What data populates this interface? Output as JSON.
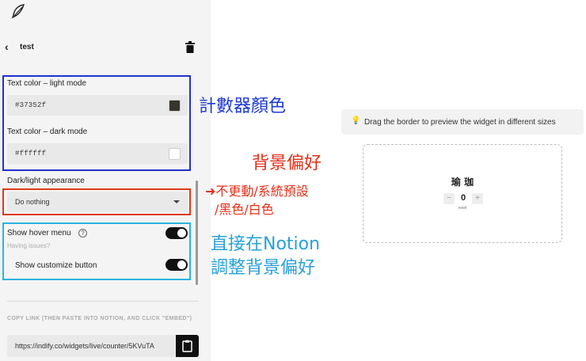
{
  "header": {
    "title": "test"
  },
  "settings": {
    "text_color_light": {
      "label": "Text color – light mode",
      "value": "#37352f",
      "swatch": "#37352f"
    },
    "text_color_dark": {
      "label": "Text color – dark mode",
      "value": "#ffffff",
      "swatch": "#ffffff"
    },
    "appearance": {
      "label": "Dark/light appearance",
      "selected": "Do nothing"
    },
    "hover_menu": {
      "label": "Show hover menu",
      "help": "?",
      "sub_label": "Having issues?"
    },
    "customize_button": {
      "label": "Show customize button"
    }
  },
  "copy_link": {
    "caption": "COPY LINK (THEN PASTE INTO NOTION, AND CLICK \"EMBED\")",
    "url": "https://indify.co/widgets/live/counter/5KVuTA"
  },
  "annotations": {
    "blue": "計數器顏色",
    "red_title": "背景偏好",
    "red_line1": "➜不更動/系統預設",
    "red_line2": "/黑色/白色",
    "cyan_line1": "直接在Notion",
    "cyan_line2": "調整背景偏好"
  },
  "preview": {
    "tip_icon": "💡",
    "tip": "Drag the border to preview the widget in different sizes",
    "counter_title": "瑜 珈",
    "minus": "−",
    "value": "0",
    "plus": "+",
    "reset": "reset"
  },
  "colors": {
    "annotation_blue": "#1f3bd0",
    "annotation_red": "#e0311a",
    "annotation_cyan": "#2aa0d8"
  }
}
